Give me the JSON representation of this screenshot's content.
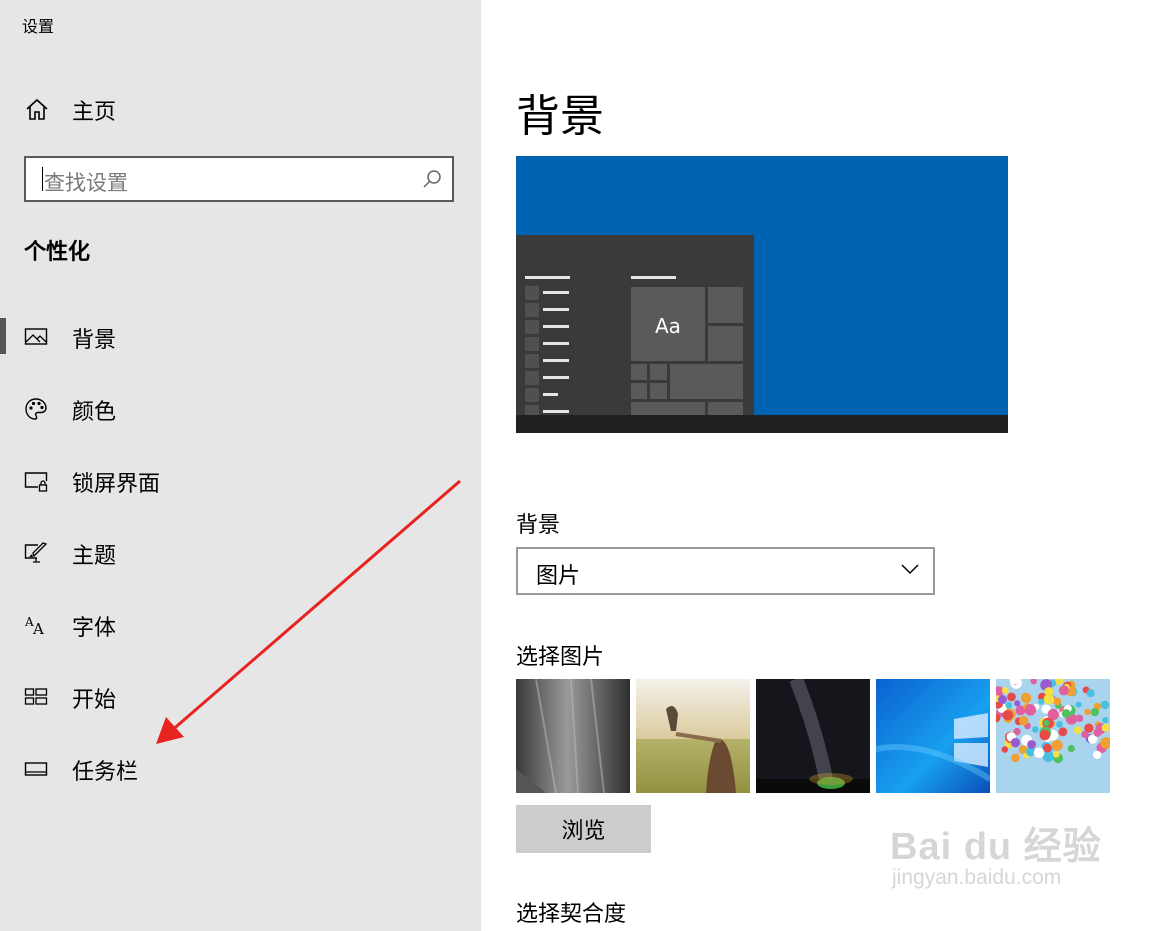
{
  "window": {
    "title": "设置"
  },
  "sidebar": {
    "home_label": "主页",
    "search_placeholder": "查找设置",
    "section_title": "个性化",
    "items": [
      {
        "label": "背景",
        "icon": "picture-icon",
        "selected": true
      },
      {
        "label": "颜色",
        "icon": "palette-icon",
        "selected": false
      },
      {
        "label": "锁屏界面",
        "icon": "lock-screen-icon",
        "selected": false
      },
      {
        "label": "主题",
        "icon": "theme-brush-icon",
        "selected": false
      },
      {
        "label": "字体",
        "icon": "font-icon",
        "selected": false
      },
      {
        "label": "开始",
        "icon": "start-tiles-icon",
        "selected": false
      },
      {
        "label": "任务栏",
        "icon": "taskbar-icon",
        "selected": false
      }
    ]
  },
  "main": {
    "title": "背景",
    "preview": {
      "tile_text": "Aa"
    },
    "background_label": "背景",
    "background_select": {
      "value": "图片"
    },
    "choose_picture_label": "选择图片",
    "thumbnails": [
      {
        "name": "rock-cliff"
      },
      {
        "name": "bird-on-hand"
      },
      {
        "name": "milky-way-tent"
      },
      {
        "name": "windows-default"
      },
      {
        "name": "balloons"
      }
    ],
    "browse_label": "浏览",
    "choose_fit_label": "选择契合度"
  },
  "watermark": {
    "main": "Bai du 经验",
    "sub": "jingyan.baidu.com"
  },
  "colors": {
    "sidebar_bg": "#e6e6e6",
    "preview_blue": "#0063b1",
    "arrow_red": "#e8231f",
    "browse_bg": "#cccccc"
  }
}
